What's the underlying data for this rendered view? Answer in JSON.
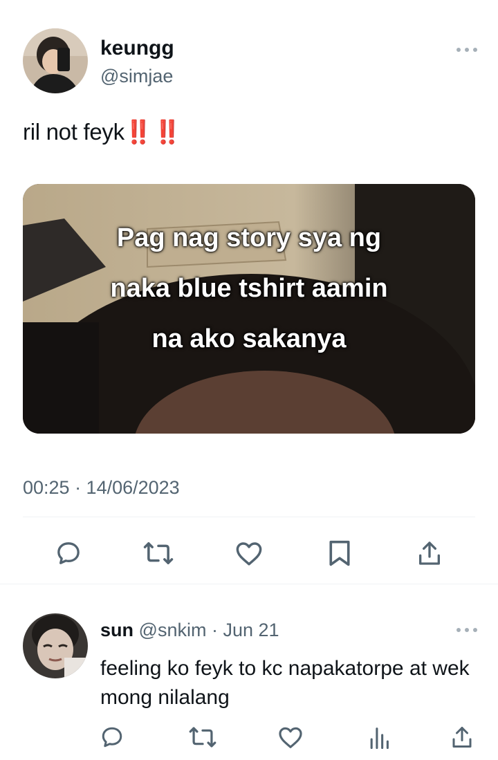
{
  "tweet": {
    "author_name": "keungg",
    "author_handle": "@simjae",
    "text": "ril not feyk",
    "text_emoji": "‼️‼️",
    "media_caption_line1": "Pag nag story sya ng",
    "media_caption_line2": "naka blue tshirt aamin",
    "media_caption_line3": "na ako sakanya",
    "timestamp": "00:25 · 14/06/2023",
    "actions": [
      "reply-icon",
      "retweet-icon",
      "like-icon",
      "bookmark-icon",
      "share-icon"
    ]
  },
  "reply": {
    "author_name": "sun",
    "author_handle": "@snkim",
    "separator": " · ",
    "date": "Jun 21",
    "text": "feeling ko feyk to kc napakatorpe at wek mong nilalang",
    "actions": [
      "reply-icon",
      "retweet-icon",
      "like-icon",
      "views-icon",
      "share-icon"
    ]
  },
  "colors": {
    "text_primary": "#0f1419",
    "text_secondary": "#536471",
    "icon": "#536471",
    "emoji_red": "#e0201c",
    "divider": "#eff3f4"
  }
}
